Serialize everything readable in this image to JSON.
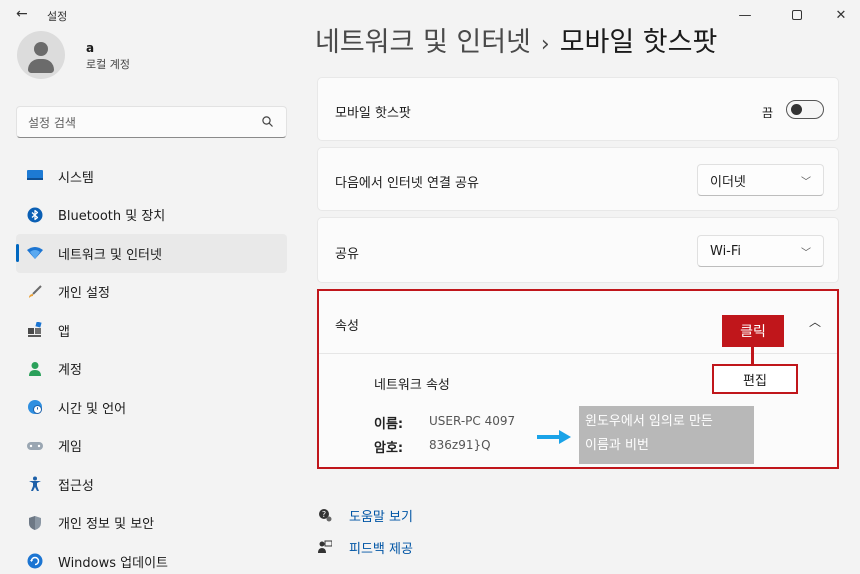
{
  "window": {
    "title": "설정",
    "back_glyph": "←",
    "min_glyph": "—",
    "close_glyph": "✕"
  },
  "profile": {
    "name": "a",
    "account_type": "로컬 계정"
  },
  "search": {
    "placeholder": "설정 검색"
  },
  "sidebar": {
    "items": [
      {
        "label": "시스템",
        "icon": "monitor-icon"
      },
      {
        "label": "Bluetooth 및 장치",
        "icon": "bluetooth-icon"
      },
      {
        "label": "네트워크 및 인터넷",
        "icon": "wifi-icon",
        "active": true
      },
      {
        "label": "개인 설정",
        "icon": "brush-icon"
      },
      {
        "label": "앱",
        "icon": "apps-icon"
      },
      {
        "label": "계정",
        "icon": "person-icon"
      },
      {
        "label": "시간 및 언어",
        "icon": "globe-clock-icon"
      },
      {
        "label": "게임",
        "icon": "gamepad-icon"
      },
      {
        "label": "접근성",
        "icon": "accessibility-icon"
      },
      {
        "label": "개인 정보 및 보안",
        "icon": "shield-icon"
      },
      {
        "label": "Windows 업데이트",
        "icon": "update-icon"
      }
    ]
  },
  "breadcrumb": {
    "parent": "네트워크 및 인터넷",
    "separator": "›",
    "current": "모바일 핫스팟"
  },
  "settings": {
    "hotspot": {
      "label": "모바일 핫스팟",
      "state_text": "끔",
      "on": false
    },
    "share_from": {
      "label": "다음에서 인터넷 연결 공유",
      "value": "이더넷"
    },
    "share_over": {
      "label": "공유",
      "value": "Wi-Fi"
    },
    "properties": {
      "title": "속성",
      "network_properties_label": "네트워크 속성",
      "edit_label": "편집",
      "name_key": "이름:",
      "name_value": "USER-PC 4097",
      "password_key": "암호:",
      "password_value": "836z91}Q"
    }
  },
  "annotations": {
    "click_label": "클릭",
    "note_line1": "윈도우에서 임의로 만든",
    "note_line2": "이름과 비번",
    "accent_red": "#c0161b",
    "arrow_blue": "#1aa3e8",
    "note_bg": "#b8b8b8"
  },
  "links": {
    "help": "도움말 보기",
    "feedback": "피드백 제공"
  },
  "colors": {
    "accent": "#0067c0",
    "link": "#0055a5"
  }
}
